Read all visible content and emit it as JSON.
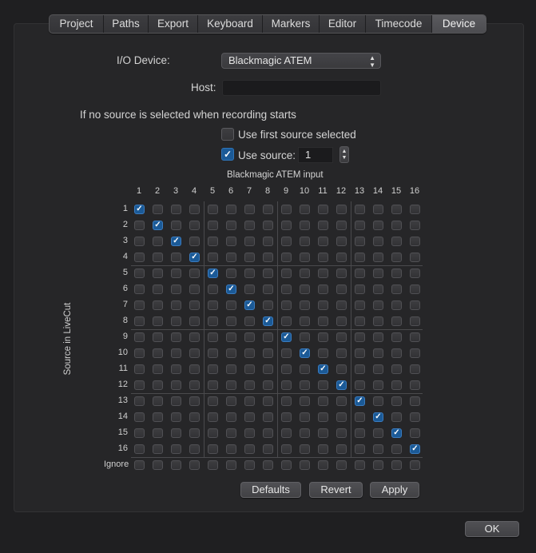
{
  "tabs": [
    "Project",
    "Paths",
    "Export",
    "Keyboard",
    "Markers",
    "Editor",
    "Timecode",
    "Device"
  ],
  "active_tab": "Device",
  "io_device": {
    "label": "I/O Device:",
    "value": "Blackmagic ATEM"
  },
  "host": {
    "label": "Host:",
    "value": ""
  },
  "no_source": {
    "heading": "If no source is selected when recording starts",
    "use_first": {
      "label": "Use first source selected",
      "checked": false
    },
    "use_source": {
      "label": "Use source:",
      "checked": true,
      "value": "1"
    }
  },
  "matrix": {
    "title": "Blackmagic ATEM input",
    "y_title": "Source in LiveCut",
    "columns": [
      "1",
      "2",
      "3",
      "4",
      "5",
      "6",
      "7",
      "8",
      "9",
      "10",
      "11",
      "12",
      "13",
      "14",
      "15",
      "16"
    ],
    "rows": [
      "1",
      "2",
      "3",
      "4",
      "5",
      "6",
      "7",
      "8",
      "9",
      "10",
      "11",
      "12",
      "13",
      "14",
      "15",
      "16",
      "Ignore"
    ],
    "checked": [
      [
        0,
        0
      ],
      [
        1,
        1
      ],
      [
        2,
        2
      ],
      [
        3,
        3
      ],
      [
        4,
        4
      ],
      [
        5,
        5
      ],
      [
        6,
        6
      ],
      [
        7,
        7
      ],
      [
        8,
        8
      ],
      [
        9,
        9
      ],
      [
        10,
        10
      ],
      [
        11,
        11
      ],
      [
        12,
        12
      ],
      [
        13,
        13
      ],
      [
        14,
        14
      ],
      [
        15,
        15
      ]
    ]
  },
  "buttons": {
    "defaults": "Defaults",
    "revert": "Revert",
    "apply": "Apply",
    "ok": "OK"
  },
  "colors": {
    "accent": "#1b5a97",
    "background": "#1f1f21"
  }
}
